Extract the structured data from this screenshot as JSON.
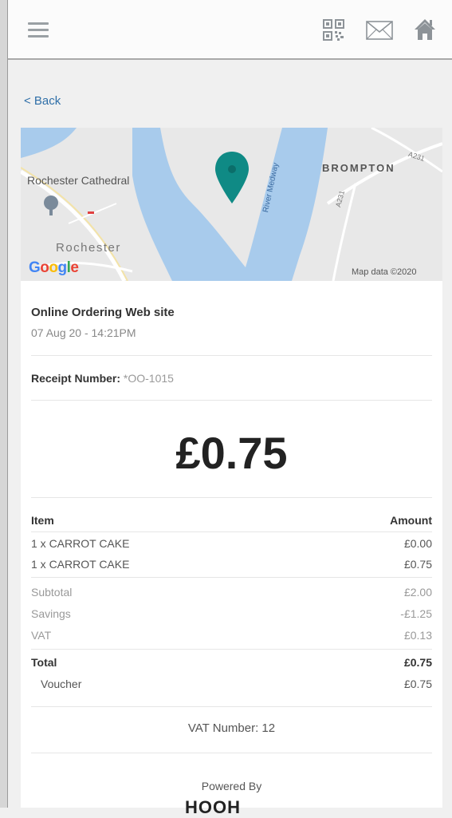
{
  "header": {
    "menu_icon": "hamburger-menu-icon",
    "qr_icon": "qr-code-icon",
    "mail_icon": "mail-icon",
    "home_icon": "home-icon"
  },
  "nav": {
    "back_label": "< Back"
  },
  "map": {
    "labels": {
      "cathedral": "Rochester Cathedral",
      "town": "Rochester",
      "district": "BROMPTON",
      "river": "River Medway",
      "road": "A231",
      "road2": "A231"
    },
    "attribution": "Map data ©2020",
    "logo_text": "Google",
    "colors": {
      "water": "#a8cbec",
      "land": "#e8e8e8",
      "marker": "#0f8a85"
    }
  },
  "receipt": {
    "merchant": "Online Ordering Web site",
    "datetime": "07 Aug 20 - 14:21PM",
    "receipt_number_label": "Receipt Number:",
    "receipt_number_value": "*OO-1015",
    "total_amount": "£0.75",
    "table_header": {
      "item": "Item",
      "amount": "Amount"
    },
    "items": [
      {
        "name": "1 x CARROT CAKE",
        "amount": "£0.00"
      },
      {
        "name": "1 x CARROT CAKE",
        "amount": "£0.75"
      }
    ],
    "summary": [
      {
        "label": "Subtotal",
        "value": "£2.00"
      },
      {
        "label": "Savings",
        "value": "-£1.25"
      },
      {
        "label": "VAT",
        "value": "£0.13"
      }
    ],
    "total": {
      "label": "Total",
      "value": "£0.75"
    },
    "voucher": {
      "label": "Voucher",
      "value": "£0.75"
    },
    "vat_number": "VAT Number: 12",
    "powered_by": "Powered By",
    "brand": "HOOH"
  }
}
